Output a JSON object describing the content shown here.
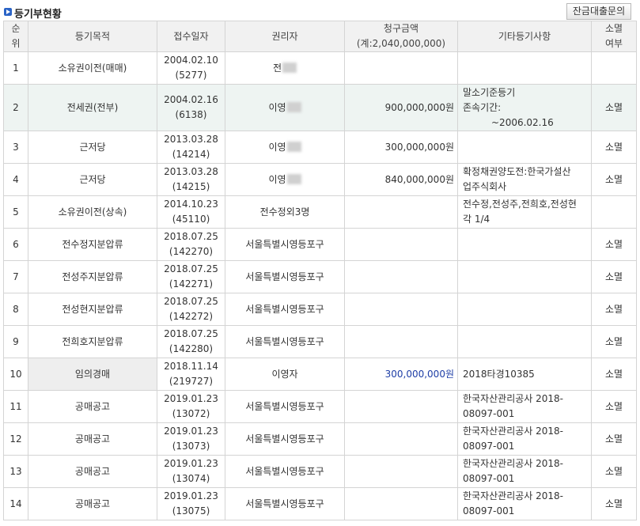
{
  "header": {
    "title": "등기부현황",
    "button_label": "잔금대출문의"
  },
  "table": {
    "columns": {
      "no_1": "순",
      "no_2": "위",
      "purpose": "등기목적",
      "date": "접수일자",
      "holder": "권리자",
      "amount_1": "청구금액",
      "amount_2": "(계:2,040,000,000)",
      "other": "기타등기사항",
      "cancel_1": "소멸",
      "cancel_2": "여부"
    },
    "rows": [
      {
        "no": "1",
        "purpose": "소유권이전(매매)",
        "date": "2004.02.10",
        "receipt": "(5277)",
        "holder": "전",
        "amount": "",
        "other": "",
        "other2": "",
        "other3": "",
        "cancel": ""
      },
      {
        "no": "2",
        "purpose": "전세권(전부)",
        "date": "2004.02.16",
        "receipt": "(6138)",
        "holder": "이영",
        "amount": "900,000,000원",
        "other": "말소기준등기",
        "other2": "존속기간:",
        "other3": "~2006.02.16",
        "cancel": "소멸"
      },
      {
        "no": "3",
        "purpose": "근저당",
        "date": "2013.03.28",
        "receipt": "(14214)",
        "holder": "이영",
        "amount": "300,000,000원",
        "other": "",
        "other2": "",
        "other3": "",
        "cancel": "소멸"
      },
      {
        "no": "4",
        "purpose": "근저당",
        "date": "2013.03.28",
        "receipt": "(14215)",
        "holder": "이영",
        "amount": "840,000,000원",
        "other": "확정채권양도전:한국가설산",
        "other2": "업주식회사",
        "other3": "",
        "cancel": "소멸"
      },
      {
        "no": "5",
        "purpose": "소유권이전(상속)",
        "date": "2014.10.23",
        "receipt": "(45110)",
        "holder": "전수정외3명",
        "amount": "",
        "other": "전수정,전성주,전희호,전성현",
        "other2": "각 1/4",
        "other3": "",
        "cancel": ""
      },
      {
        "no": "6",
        "purpose": "전수정지분압류",
        "date": "2018.07.25",
        "receipt": "(142270)",
        "holder": "서울특별시영등포구",
        "amount": "",
        "other": "",
        "other2": "",
        "other3": "",
        "cancel": "소멸"
      },
      {
        "no": "7",
        "purpose": "전성주지분압류",
        "date": "2018.07.25",
        "receipt": "(142271)",
        "holder": "서울특별시영등포구",
        "amount": "",
        "other": "",
        "other2": "",
        "other3": "",
        "cancel": "소멸"
      },
      {
        "no": "8",
        "purpose": "전성현지분압류",
        "date": "2018.07.25",
        "receipt": "(142272)",
        "holder": "서울특별시영등포구",
        "amount": "",
        "other": "",
        "other2": "",
        "other3": "",
        "cancel": "소멸"
      },
      {
        "no": "9",
        "purpose": "전희호지분압류",
        "date": "2018.07.25",
        "receipt": "(142280)",
        "holder": "서울특별시영등포구",
        "amount": "",
        "other": "",
        "other2": "",
        "other3": "",
        "cancel": "소멸"
      },
      {
        "no": "10",
        "purpose": "임의경매",
        "date": "2018.11.14",
        "receipt": "(219727)",
        "holder": "이영자",
        "amount": "300,000,000원",
        "other": "2018타경10385",
        "other2": "",
        "other3": "",
        "cancel": "소멸"
      },
      {
        "no": "11",
        "purpose": "공매공고",
        "date": "2019.01.23",
        "receipt": "(13072)",
        "holder": "서울특별시영등포구",
        "amount": "",
        "other": "한국자산관리공사 2018-",
        "other2": "08097-001",
        "other3": "",
        "cancel": "소멸"
      },
      {
        "no": "12",
        "purpose": "공매공고",
        "date": "2019.01.23",
        "receipt": "(13073)",
        "holder": "서울특별시영등포구",
        "amount": "",
        "other": "한국자산관리공사 2018-",
        "other2": "08097-001",
        "other3": "",
        "cancel": "소멸"
      },
      {
        "no": "13",
        "purpose": "공매공고",
        "date": "2019.01.23",
        "receipt": "(13074)",
        "holder": "서울특별시영등포구",
        "amount": "",
        "other": "한국자산관리공사 2018-",
        "other2": "08097-001",
        "other3": "",
        "cancel": "소멸"
      },
      {
        "no": "14",
        "purpose": "공매공고",
        "date": "2019.01.23",
        "receipt": "(13075)",
        "holder": "서울특별시영등포구",
        "amount": "",
        "other": "한국자산관리공사 2018-",
        "other2": "08097-001",
        "other3": "",
        "cancel": "소멸"
      }
    ]
  },
  "colors": {
    "title_icon": "#2a63c6",
    "highlight_row": "#eef4f2",
    "auction_amount": "#1e3ea6"
  }
}
